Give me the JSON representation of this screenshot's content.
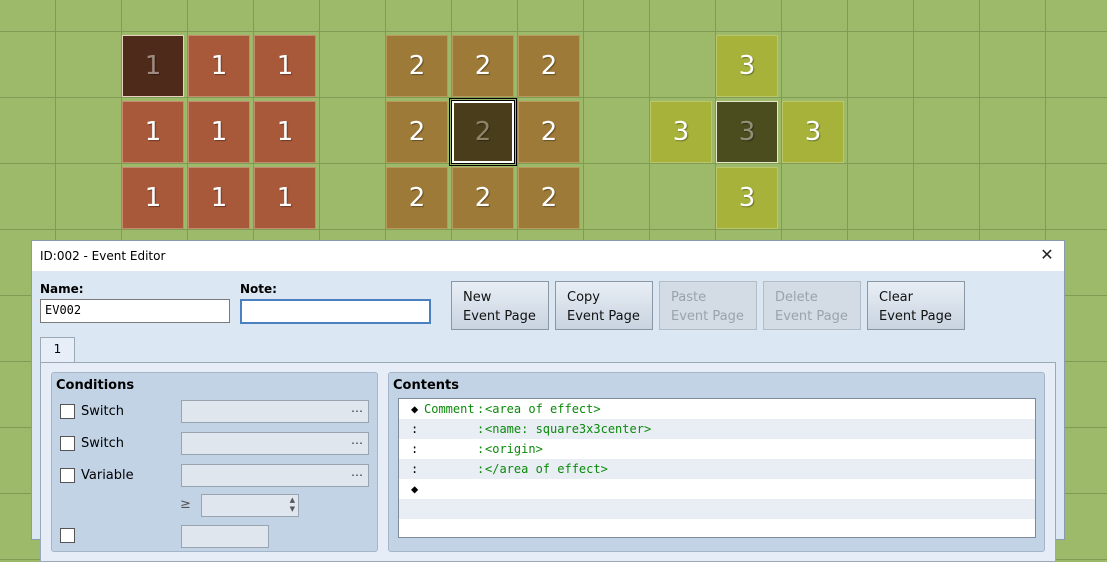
{
  "map": {
    "group1": {
      "label": "1",
      "center_label": "1"
    },
    "group2": {
      "label": "2",
      "center_label": "2"
    },
    "group3": {
      "label": "3",
      "center_label": "3"
    }
  },
  "dialog": {
    "title": "ID:002 - Event Editor",
    "close_glyph": "✕",
    "name_label": "Name:",
    "name_value": "EV002",
    "note_label": "Note:",
    "note_value": "",
    "buttons": {
      "new": [
        "New",
        "Event Page"
      ],
      "copy": [
        "Copy",
        "Event Page"
      ],
      "paste": [
        "Paste",
        "Event Page"
      ],
      "delete": [
        "Delete",
        "Event Page"
      ],
      "clear": [
        "Clear",
        "Event Page"
      ]
    },
    "tab_label": "1",
    "conditions": {
      "title": "Conditions",
      "switch1": "Switch",
      "switch2": "Switch",
      "variable": "Variable",
      "dots": "…",
      "gte": "≥",
      "up": "▲",
      "down": "▼"
    },
    "contents": {
      "title": "Contents",
      "rows": [
        {
          "mark": "◆",
          "cmd": "Comment",
          "colon": ":",
          "text": "<area of effect>"
        },
        {
          "mark": ":",
          "cmd": "",
          "colon": ":",
          "text": "<name: square3x3center>"
        },
        {
          "mark": ":",
          "cmd": "",
          "colon": ":",
          "text": "<origin>"
        },
        {
          "mark": ":",
          "cmd": "",
          "colon": ":",
          "text": "</area of effect>"
        },
        {
          "mark": "◆",
          "cmd": "",
          "colon": "",
          "text": ""
        },
        {
          "mark": "",
          "cmd": "",
          "colon": "",
          "text": ""
        }
      ]
    }
  }
}
